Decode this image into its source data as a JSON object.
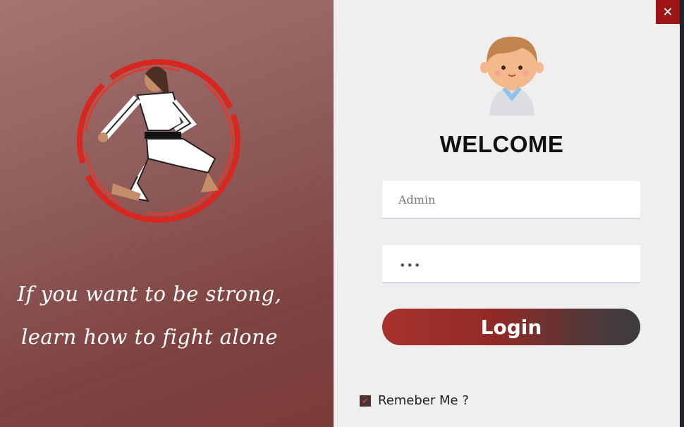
{
  "left_panel": {
    "quote_line1": "If you want to be strong,",
    "quote_line2": "learn how to fight alone"
  },
  "right_panel": {
    "title": "WELCOME",
    "username": {
      "value": "Admin",
      "placeholder": "Admin"
    },
    "password": {
      "display": "•••"
    },
    "login_label": "Login",
    "remember_label": "Remeber Me ?",
    "remember_checked": true
  },
  "window": {
    "close_glyph": "✕"
  },
  "colors": {
    "accent": "#9b1515",
    "panel_left": "#8a5250",
    "login_start": "#a8322c",
    "login_end": "#3c3c3e"
  },
  "icons": [
    "karate-logo-icon",
    "avatar-icon",
    "close-icon",
    "checkbox-icon"
  ]
}
